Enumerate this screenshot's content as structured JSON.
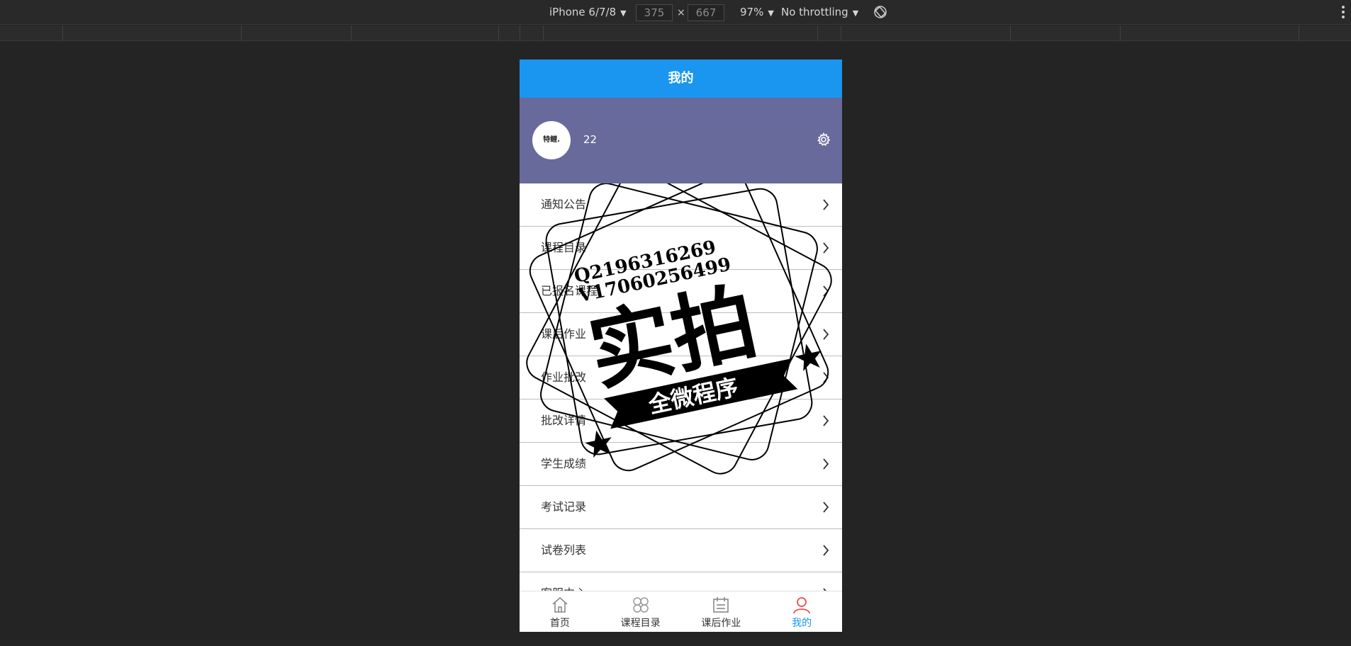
{
  "devtools": {
    "device": "iPhone 6/7/8",
    "width_value": "375",
    "height_value": "667",
    "times_sign": "×",
    "zoom": "97%",
    "throttling": "No throttling"
  },
  "app": {
    "title": "我的",
    "profile": {
      "avatar_text": "特鲤.",
      "username": "22"
    },
    "menu": [
      {
        "label": "通知公告"
      },
      {
        "label": "课程目录"
      },
      {
        "label": "已报名课程"
      },
      {
        "label": "课后作业"
      },
      {
        "label": "作业批改"
      },
      {
        "label": "批改详情"
      },
      {
        "label": "学生成绩"
      },
      {
        "label": "考试记录"
      },
      {
        "label": "试卷列表"
      },
      {
        "label": "客服中心"
      }
    ],
    "tabs": [
      {
        "label": "首页",
        "icon": "home-icon"
      },
      {
        "label": "课程目录",
        "icon": "grid-flower-icon"
      },
      {
        "label": "课后作业",
        "icon": "calendar-icon"
      },
      {
        "label": "我的",
        "icon": "person-icon",
        "active": true
      }
    ],
    "colors": {
      "navbar": "#1a96f0",
      "profile_bg": "#686a9b",
      "active_tab": "#1a96f0"
    }
  },
  "watermark": {
    "line1": "Q2196316269",
    "line2": "V17060256499",
    "big": "实拍",
    "ribbon": "全微程序"
  }
}
